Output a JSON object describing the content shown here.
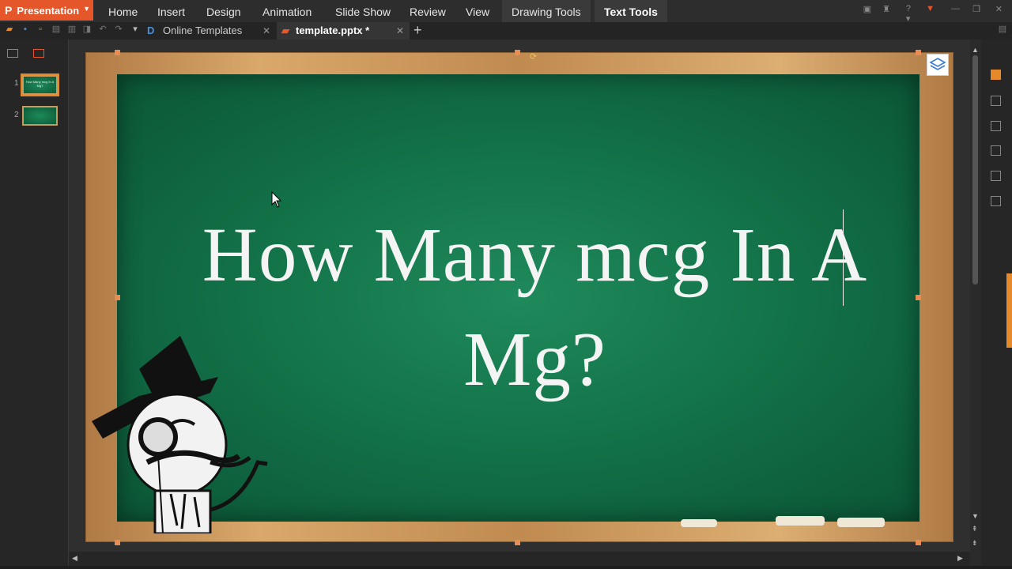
{
  "app": {
    "name": "Presentation",
    "accent": "#e5562a"
  },
  "menu": {
    "items": [
      "Home",
      "Insert",
      "Design",
      "Animation",
      "Slide Show",
      "Review",
      "View"
    ],
    "context_tabs": [
      "Drawing Tools",
      "Text Tools"
    ],
    "active_context": "Text Tools"
  },
  "tabs": [
    {
      "label": "Online Templates",
      "icon": "online-templates-icon"
    },
    {
      "label": "template.pptx *",
      "icon": "pptx-file-icon",
      "current": true
    }
  ],
  "sidebar": {
    "slides": [
      {
        "number": "1",
        "thumb_text": "How Many mcg In A Mg?",
        "selected": true
      },
      {
        "number": "2",
        "thumb_text": "",
        "selected": false
      }
    ]
  },
  "slide": {
    "title_line1": "How Many mcg In A",
    "title_line2": "Mg?",
    "board_color": "#137349",
    "frame_color": "#d9a86a"
  }
}
